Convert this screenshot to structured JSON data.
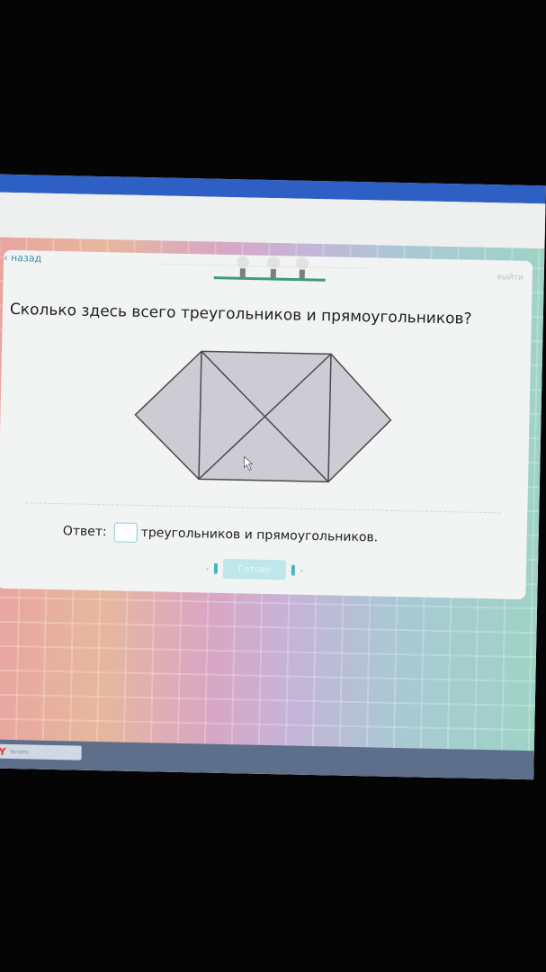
{
  "nav": {
    "back_label": "назад",
    "exit_label": "выйти"
  },
  "question": {
    "title": "Сколько здесь всего треугольников и прямоугольников?"
  },
  "answer": {
    "prefix": "Ответ:",
    "value": "",
    "suffix": "треугольников и прямоугольников."
  },
  "check_button": {
    "label": "Готово"
  },
  "taskbar": {
    "item_label": "Yandex",
    "icon": "yandex-icon"
  },
  "colors": {
    "accent": "#3a8fb0",
    "progress_track": "#3e9c7a",
    "figure_fill": "#cdcbd3",
    "button_bg": "#bfe6ea"
  },
  "progress": {
    "bulbs": 3
  }
}
